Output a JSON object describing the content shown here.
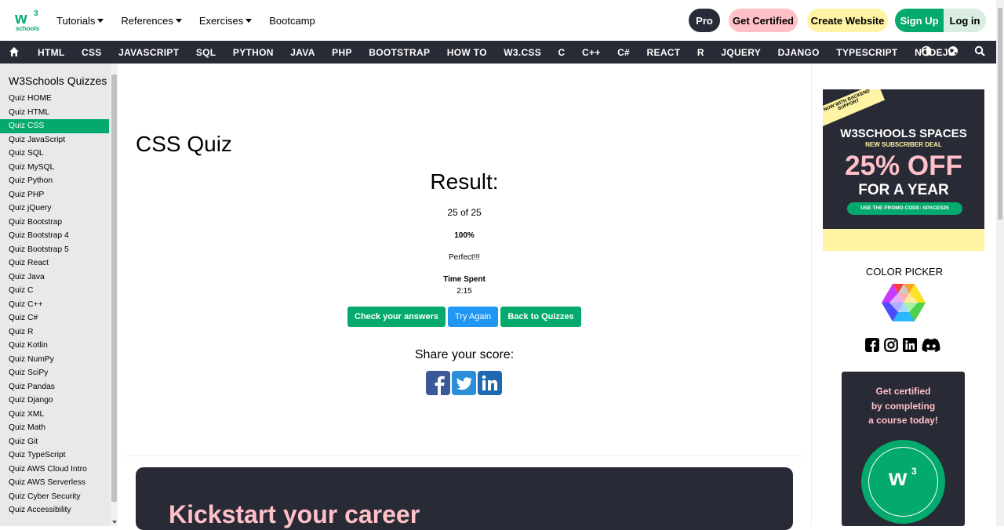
{
  "header": {
    "logo_text": "schools",
    "nav": [
      "Tutorials",
      "References",
      "Exercises",
      "Bootcamp"
    ],
    "buttons": {
      "pro": "Pro",
      "get_certified": "Get Certified",
      "create_website": "Create Website",
      "sign_up": "Sign Up",
      "log_in": "Log in"
    }
  },
  "topnav": {
    "items": [
      "HTML",
      "CSS",
      "JAVASCRIPT",
      "SQL",
      "PYTHON",
      "JAVA",
      "PHP",
      "BOOTSTRAP",
      "HOW TO",
      "W3.CSS",
      "C",
      "C++",
      "C#",
      "REACT",
      "R",
      "JQUERY",
      "DJANGO",
      "TYPESCRIPT",
      "NODEJS"
    ]
  },
  "sidebar": {
    "title": "W3Schools Quizzes",
    "items": [
      "Quiz HOME",
      "Quiz HTML",
      "Quiz CSS",
      "Quiz JavaScript",
      "Quiz SQL",
      "Quiz MySQL",
      "Quiz Python",
      "Quiz PHP",
      "Quiz jQuery",
      "Quiz Bootstrap",
      "Quiz Bootstrap 4",
      "Quiz Bootstrap 5",
      "Quiz React",
      "Quiz Java",
      "Quiz C",
      "Quiz C++",
      "Quiz C#",
      "Quiz R",
      "Quiz Kotlin",
      "Quiz NumPy",
      "Quiz SciPy",
      "Quiz Pandas",
      "Quiz Django",
      "Quiz XML",
      "Quiz Math",
      "Quiz Git",
      "Quiz TypeScript",
      "Quiz AWS Cloud Intro",
      "Quiz AWS Serverless",
      "Quiz Cyber Security",
      "Quiz Accessibility"
    ],
    "active_index": 2
  },
  "main": {
    "title": "CSS Quiz",
    "result_heading": "Result:",
    "score": "25 of 25",
    "percent": "100%",
    "message": "Perfect!!!",
    "time_label": "Time Spent",
    "time_value": "2:15",
    "buttons": {
      "check": "Check your answers",
      "try_again": "Try Again",
      "back": "Back to Quizzes"
    },
    "share_label": "Share your score:",
    "career_heading": "Kickstart your career"
  },
  "right": {
    "ad": {
      "ribbon": "NOW WITH BACKEND SUPPORT",
      "title": "W3SCHOOLS SPACES",
      "subtitle": "NEW SUBSCRIBER DEAL",
      "offer": "25% OFF",
      "offer_sub": "FOR A YEAR",
      "promo": "USE THE PROMO CODE: SPACES25"
    },
    "color_picker_label": "COLOR PICKER",
    "cert": {
      "line1": "Get certified",
      "line2": "by completing",
      "line3": "a course today!"
    }
  },
  "colors": {
    "green": "#04aa6d",
    "dark": "#282a35",
    "pink": "#ffc0c7",
    "yellow": "#fff4a3",
    "blue": "#2196f3",
    "social_blue": "#3b5998"
  }
}
